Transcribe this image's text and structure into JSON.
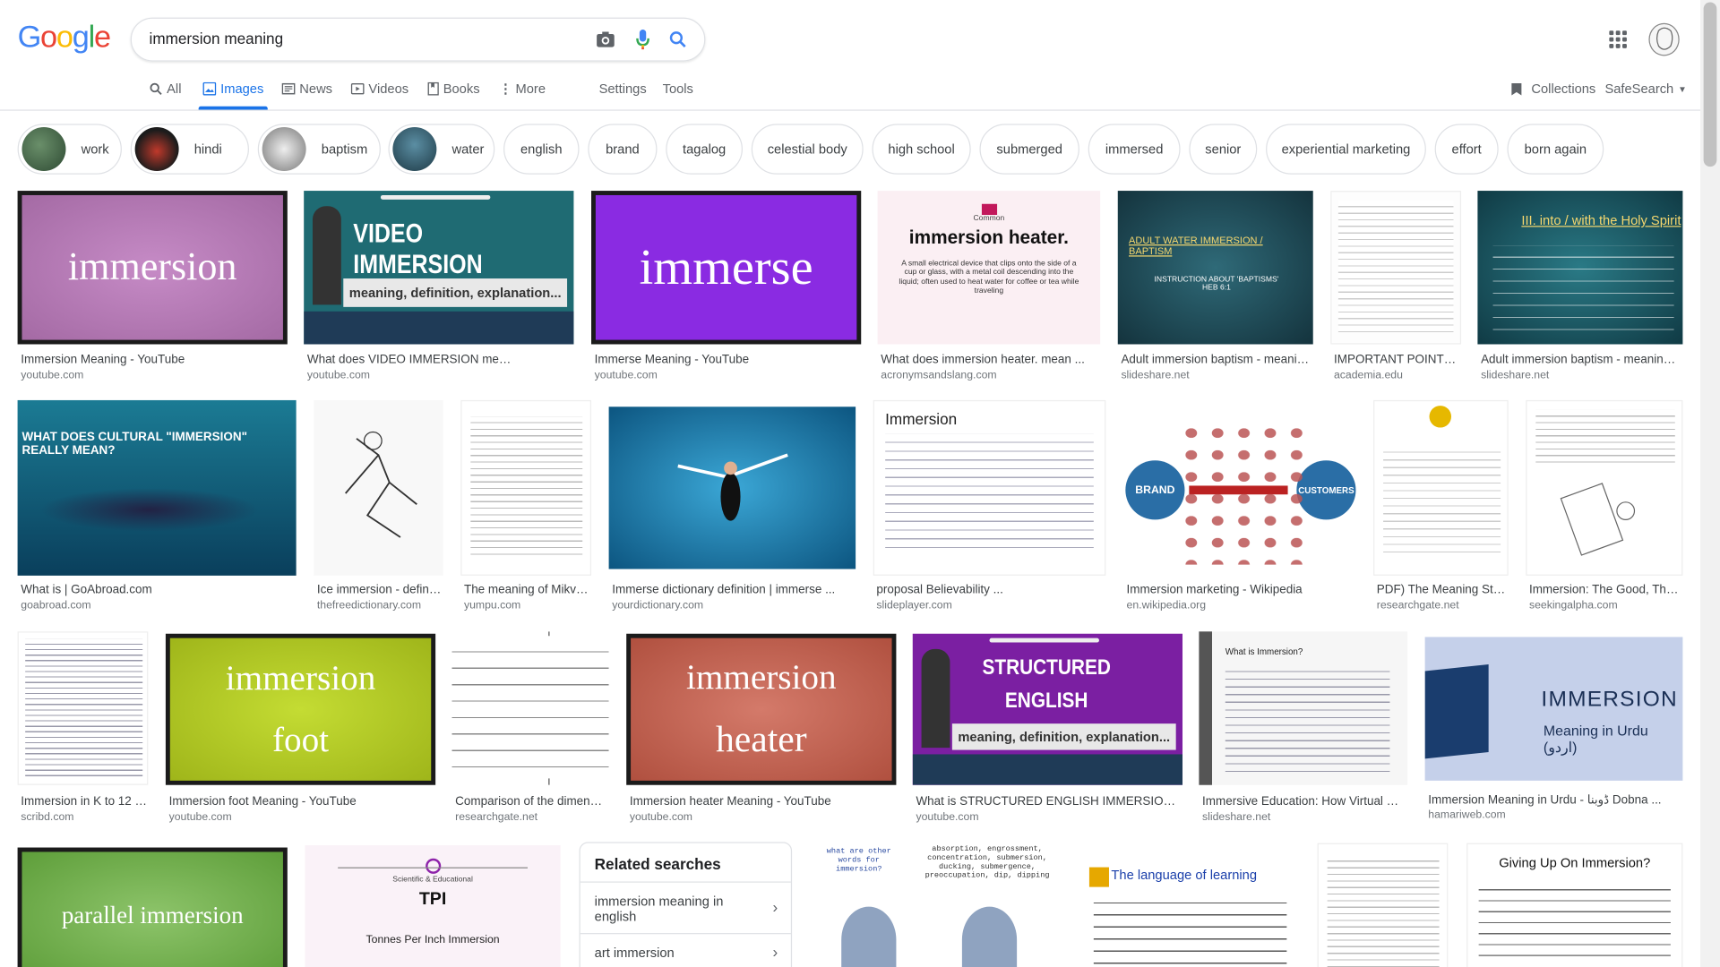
{
  "search": {
    "query": "immersion meaning"
  },
  "logo": {
    "text": "Google"
  },
  "tabs": [
    {
      "label": "All"
    },
    {
      "label": "Images"
    },
    {
      "label": "News"
    },
    {
      "label": "Videos"
    },
    {
      "label": "Books"
    },
    {
      "label": "More"
    }
  ],
  "tools": {
    "settings": "Settings",
    "tools": "Tools",
    "collections": "Collections",
    "safesearch": "SafeSearch"
  },
  "chips": [
    "work",
    "hindi",
    "baptism",
    "water",
    "english",
    "brand",
    "tagalog",
    "celestial body",
    "high school",
    "submerged",
    "immersed",
    "senior",
    "experiential marketing",
    "effort",
    "born again"
  ],
  "results": [
    {
      "caption": "Immersion Meaning - YouTube",
      "source": "youtube.com",
      "text": "immersion"
    },
    {
      "caption": "What does VIDEO IMMERSION mean ...",
      "source": "youtube.com",
      "text": "VIDEO IMMERSION",
      "sub": "meaning, definition, explanation..."
    },
    {
      "caption": "Immerse Meaning - YouTube",
      "source": "youtube.com",
      "text": "immerse"
    },
    {
      "caption": "What does immersion heater. mean ...",
      "source": "acronymsandslang.com",
      "text": "immersion heater.",
      "top": "Common",
      "sub": "A small electrical device that clips onto the side of a cup or glass, with a metal coil descending into the liquid; often used to heat water for coffee or tea while traveling"
    },
    {
      "caption": "Adult immersion baptism - meaning...",
      "source": "slideshare.net",
      "text": "ADULT WATER IMMERSION / BAPTISM",
      "sub": "INSTRUCTION ABOUT 'BAPTISMS' HEB 6:1"
    },
    {
      "caption": "IMPORTANT POINTS ...",
      "source": "academia.edu"
    },
    {
      "caption": "Adult immersion baptism - meaning a...",
      "source": "slideshare.net",
      "text": "III. into / with the Holy Spirit"
    },
    {
      "caption": "What is | GoAbroad.com",
      "source": "goabroad.com",
      "text": "WHAT DOES CULTURAL \"IMMERSION\" REALLY MEAN?"
    },
    {
      "caption": "Ice immersion - definiti...",
      "source": "thefreedictionary.com"
    },
    {
      "caption": "The meaning of Mikva...",
      "source": "yumpu.com"
    },
    {
      "caption": "Immerse dictionary definition | immerse ...",
      "source": "yourdictionary.com"
    },
    {
      "caption": "proposal Believability ...",
      "source": "slideplayer.com",
      "text": "Immersion"
    },
    {
      "caption": "Immersion marketing - Wikipedia",
      "source": "en.wikipedia.org",
      "left": "BRAND",
      "right": "CUSTOMERS"
    },
    {
      "caption": "PDF) The Meaning Stu...",
      "source": "researchgate.net"
    },
    {
      "caption": "Immersion: The Good, The ...",
      "source": "seekingalpha.com"
    },
    {
      "caption": "Immersion in K to 12 | ...",
      "source": "scribd.com"
    },
    {
      "caption": "Immersion foot Meaning - YouTube",
      "source": "youtube.com",
      "text": "immersion",
      "sub": "foot"
    },
    {
      "caption": "Comparison of the dimensi...",
      "source": "researchgate.net"
    },
    {
      "caption": "Immersion heater Meaning - YouTube",
      "source": "youtube.com",
      "text": "immersion",
      "sub": "heater"
    },
    {
      "caption": "What is STRUCTURED ENGLISH IMMERSION ...",
      "source": "youtube.com",
      "text": "STRUCTURED ENGLISH IMMERSION",
      "sub": "meaning, definition, explanation..."
    },
    {
      "caption": "Immersive Education: How Virtual Obj...",
      "source": "slideshare.net",
      "text": "What is Immersion?"
    },
    {
      "caption": "Immersion Meaning in Urdu - ڈوبنا Dobna ...",
      "source": "hamariweb.com",
      "text": "IMMERSION",
      "sub": "Meaning in Urdu (اردو)"
    },
    {
      "text": "parallel immersion"
    },
    {
      "text": "TPI",
      "top": "Scientific & Educational",
      "sub": "Tonnes Per Inch Immersion"
    },
    {
      "text": "absorption, engrossment, concentration, submersion, ducking, submergence, preoccupation, dip, dipping",
      "sub": "what are other words for immersion?"
    },
    {
      "text": "The language of learning"
    },
    {},
    {
      "text": "Giving Up On Immersion?"
    }
  ],
  "related": {
    "title": "Related searches",
    "items": [
      {
        "label": "immersion meaning in english"
      },
      {
        "label": "art immersion"
      }
    ]
  }
}
